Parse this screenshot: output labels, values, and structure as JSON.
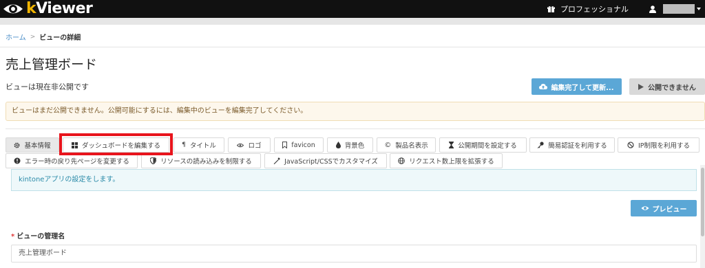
{
  "app": {
    "logo_k": "k",
    "logo_rest": "Viewer"
  },
  "header": {
    "plan_label": "プロフェッショナル",
    "user_name": ""
  },
  "breadcrumb": {
    "home": "ホーム",
    "separator": ">",
    "current": "ビューの詳細"
  },
  "page": {
    "title": "売上管理ボード",
    "status": "ビューは現在非公開です",
    "update_button": "編集完了して更新...",
    "publish_button": "公開できません",
    "warning": "ビューはまだ公開できません。公開可能にするには、編集中のビューを編集完了してください。"
  },
  "tabs": [
    {
      "label": "基本情報",
      "icon": "gear-icon"
    },
    {
      "label": "ダッシュボードを編集する",
      "icon": "grid-icon"
    },
    {
      "label": "タイトル",
      "icon": "paragraph-icon"
    },
    {
      "label": "ロゴ",
      "icon": "eye-icon"
    },
    {
      "label": "favicon",
      "icon": "bookmark-icon"
    },
    {
      "label": "背景色",
      "icon": "drop-icon"
    },
    {
      "label": "製品名表示",
      "icon": "copyright-icon"
    },
    {
      "label": "公開期間を設定する",
      "icon": "hourglass-icon"
    },
    {
      "label": "簡易認証を利用する",
      "icon": "key-icon"
    },
    {
      "label": "IP制限を利用する",
      "icon": "ban-icon"
    },
    {
      "label": "エラー時の戻り先ページを変更する",
      "icon": "alert-circle-icon"
    },
    {
      "label": "リソースの読み込みを制限する",
      "icon": "shield-icon"
    },
    {
      "label": "JavaScript/CSSでカスタマイズ",
      "icon": "wrench-icon"
    },
    {
      "label": "リクエスト数上限を拡張する",
      "icon": "globe-icon"
    }
  ],
  "info": {
    "text": "kintoneアプリの設定をします。"
  },
  "preview_button": "プレビュー",
  "form": {
    "required_mark": "*",
    "label": "ビューの管理名",
    "value": "売上管理ボード"
  },
  "colors": {
    "accent": "#5ba7d6",
    "highlight": "#e8141c",
    "topbar": "#111111"
  }
}
